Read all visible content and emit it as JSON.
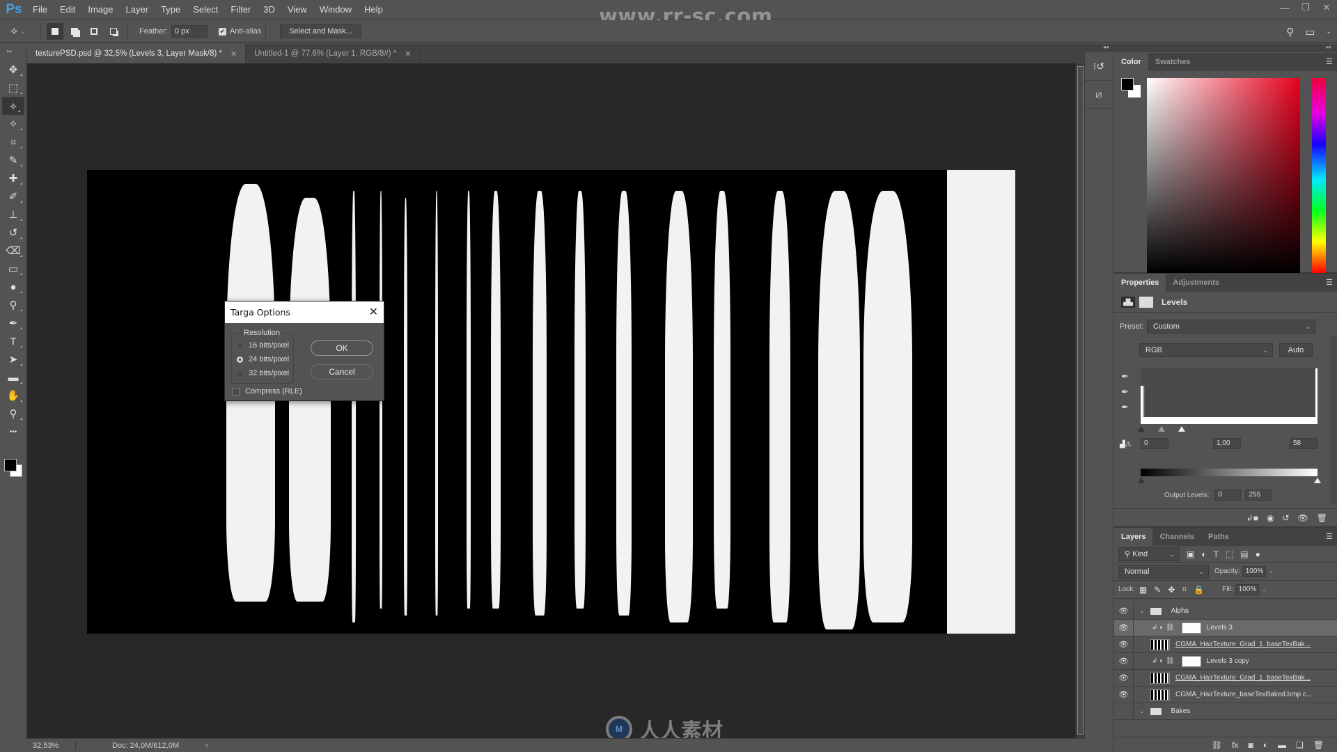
{
  "app": {
    "logo": "Ps",
    "menu": [
      "File",
      "Edit",
      "Image",
      "Layer",
      "Type",
      "Select",
      "Filter",
      "3D",
      "View",
      "Window",
      "Help"
    ],
    "window_controls": {
      "minimize": "—",
      "restore": "❐",
      "close": "✕"
    },
    "watermark_url": "www.rr-sc.com",
    "watermark_logo_text": "人人素材",
    "watermark_logo_badge": "M"
  },
  "options_bar": {
    "tool_icon": "polygonal-lasso-icon",
    "feather_label": "Feather:",
    "feather_value": "0 px",
    "antialias_label": "Anti-alias",
    "antialias_checked": true,
    "select_mask_label": "Select and Mask..."
  },
  "tabs": [
    {
      "label": "texturePSD.psd @ 32,5% (Levels 3, Layer Mask/8) *",
      "active": true,
      "close": "✕"
    },
    {
      "label": "Untitled-1 @ 77,6% (Layer 1, RGB/8#) *",
      "active": false,
      "close": "✕"
    }
  ],
  "tools": [
    {
      "name": "move-tool",
      "glyph": "✥"
    },
    {
      "name": "marquee-tool",
      "glyph": "⬚"
    },
    {
      "name": "polygonal-lasso-tool",
      "glyph": "⟡",
      "active": true
    },
    {
      "name": "magic-wand-tool",
      "glyph": "✧"
    },
    {
      "name": "crop-tool",
      "glyph": "⌗"
    },
    {
      "name": "eyedropper-tool",
      "glyph": "✎"
    },
    {
      "name": "healing-brush-tool",
      "glyph": "✚"
    },
    {
      "name": "brush-tool",
      "glyph": "✐"
    },
    {
      "name": "clone-stamp-tool",
      "glyph": "⊥"
    },
    {
      "name": "history-brush-tool",
      "glyph": "↺"
    },
    {
      "name": "eraser-tool",
      "glyph": "⌫"
    },
    {
      "name": "gradient-tool",
      "glyph": "▭"
    },
    {
      "name": "blur-tool",
      "glyph": "●"
    },
    {
      "name": "dodge-tool",
      "glyph": "⚲"
    },
    {
      "name": "pen-tool",
      "glyph": "✒"
    },
    {
      "name": "type-tool",
      "glyph": "T"
    },
    {
      "name": "path-selection-tool",
      "glyph": "➤"
    },
    {
      "name": "rectangle-tool",
      "glyph": "▬"
    },
    {
      "name": "hand-tool",
      "glyph": "✋"
    },
    {
      "name": "zoom-tool",
      "glyph": "⚲"
    },
    {
      "name": "more-tools",
      "glyph": "•••"
    }
  ],
  "dialog": {
    "title": "Targa Options",
    "close": "✕",
    "group_label": "Resolution",
    "options": [
      {
        "label": "16 bits/pixel",
        "selected": false
      },
      {
        "label": "24 bits/pixel",
        "selected": true
      },
      {
        "label": "32 bits/pixel",
        "selected": false
      }
    ],
    "compress_label": "Compress (RLE)",
    "compress_checked": false,
    "ok_label": "OK",
    "cancel_label": "Cancel"
  },
  "status": {
    "zoom": "32,53%",
    "doc": "Doc: 24,0M/612,0M",
    "arrow": "›"
  },
  "color_panel": {
    "tabs": [
      "Color",
      "Swatches"
    ],
    "foreground": "#000000",
    "background": "#ffffff",
    "hue_color": "#e8001c"
  },
  "properties_panel": {
    "tabs": [
      "Properties",
      "Adjustments"
    ],
    "title": "Levels",
    "preset_label": "Preset:",
    "preset_value": "Custom",
    "channel_value": "RGB",
    "auto_label": "Auto",
    "input_black": "0",
    "input_gamma": "1,00",
    "input_white": "58",
    "output_label": "Output Levels:",
    "output_black": "0",
    "output_white": "255"
  },
  "layers_panel": {
    "tabs": [
      "Layers",
      "Channels",
      "Paths"
    ],
    "filter_label": "Kind",
    "blend_mode": "Normal",
    "opacity_label": "Opacity:",
    "opacity_value": "100%",
    "lock_label": "Lock:",
    "fill_label": "Fill:",
    "fill_value": "100%",
    "layers": [
      {
        "name": "Alpha",
        "type": "group",
        "visible": true
      },
      {
        "name": "Levels 3",
        "type": "adjustment",
        "visible": true,
        "selected": true
      },
      {
        "name": "CGMA_HairTexture_Grad_1_baseTexBak...",
        "type": "image",
        "visible": true,
        "underline": true
      },
      {
        "name": "Levels 3 copy",
        "type": "adjustment",
        "visible": true
      },
      {
        "name": "CGMA_HairTexture_Grad_1_baseTexBak...",
        "type": "image",
        "visible": true,
        "underline": true
      },
      {
        "name": "CGMA_HairTexture_baseTexBaked.bmp c...",
        "type": "image",
        "visible": true
      },
      {
        "name": "Bakes",
        "type": "group",
        "visible": false
      }
    ]
  }
}
